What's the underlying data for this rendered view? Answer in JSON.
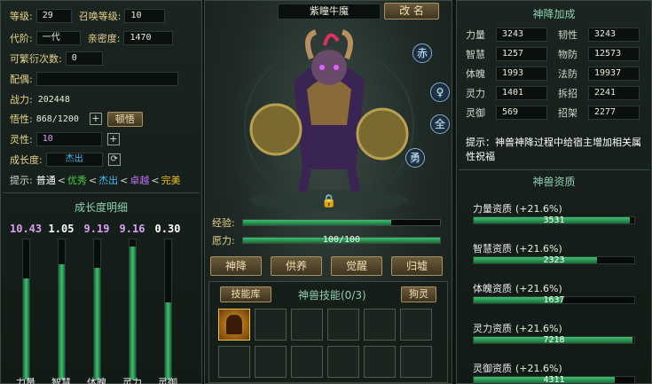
{
  "left": {
    "level_label": "等级:",
    "level": "29",
    "summon_level_label": "召唤等级:",
    "summon_level": "10",
    "generation_label": "代阶:",
    "generation": "一代",
    "intimacy_label": "亲密度:",
    "intimacy": "1470",
    "breed_label": "可繁衍次数:",
    "breed": "0",
    "mate_label": "配偶:",
    "mate": "",
    "power_label": "战力:",
    "power": "202448",
    "insight_label": "悟性:",
    "insight": "868/1200",
    "insight_button": "顿悟",
    "spirit_label": "灵性:",
    "spirit": "10",
    "growth_label": "成长度:",
    "growth": "杰出",
    "hint_label": "提示:",
    "hint_grades": [
      {
        "text": "普通",
        "color": "#ffffff"
      },
      {
        "text": "优秀",
        "color": "#4ad04a"
      },
      {
        "text": "杰出",
        "color": "#4ab8f0"
      },
      {
        "text": "卓越",
        "color": "#c070f0"
      },
      {
        "text": "完美",
        "color": "#f0c020"
      }
    ],
    "hint_separator": "<",
    "growth_title": "成长度明细",
    "growth_bars": [
      {
        "label": "力量",
        "value": "10.43",
        "color": "#d8a0f0",
        "fill": 0.72
      },
      {
        "label": "智慧",
        "value": "1.05",
        "color": "#ffffff",
        "fill": 0.82
      },
      {
        "label": "体魄",
        "value": "9.19",
        "color": "#d8a0f0",
        "fill": 0.8
      },
      {
        "label": "灵力",
        "value": "9.16",
        "color": "#d8a0f0",
        "fill": 0.95
      },
      {
        "label": "灵御",
        "value": "0.30",
        "color": "#ffffff",
        "fill": 0.55
      }
    ]
  },
  "center": {
    "pet_name": "紫瞳牛魔",
    "rename_button": "改 名",
    "side_icons": [
      "赤",
      "♀",
      "全",
      "勇"
    ],
    "exp_label": "经验:",
    "exp_value": "",
    "exp_fill": 0.75,
    "wish_label": "愿力:",
    "wish_value": "100/100",
    "wish_fill": 1.0,
    "actions": [
      "神降",
      "供养",
      "觉醒",
      "归墟"
    ],
    "skill_lib_button": "技能库",
    "skill_title": "神兽技能(0/3)",
    "capture_button": "狗灵"
  },
  "right": {
    "title": "神降加成",
    "stats": [
      {
        "label": "力量",
        "value": "3243"
      },
      {
        "label": "韧性",
        "value": "3243"
      },
      {
        "label": "智慧",
        "value": "1257"
      },
      {
        "label": "物防",
        "value": "12573"
      },
      {
        "label": "体魄",
        "value": "1993"
      },
      {
        "label": "法防",
        "value": "19937"
      },
      {
        "label": "灵力",
        "value": "1401"
      },
      {
        "label": "拆招",
        "value": "2241"
      },
      {
        "label": "灵御",
        "value": "569"
      },
      {
        "label": "招架",
        "value": "2277"
      }
    ],
    "tip": "提示：神兽神降过程中给宿主增加相关属性祝福",
    "aptitude_title": "神兽资质",
    "aptitudes": [
      {
        "label": "力量资质",
        "pct": "(+21.6%)",
        "value": "3531",
        "fill": 0.97
      },
      {
        "label": "智慧资质",
        "pct": "(+21.6%)",
        "value": "2323",
        "fill": 0.77
      },
      {
        "label": "体魄资质",
        "pct": "(+21.6%)",
        "value": "1637",
        "fill": 0.55
      },
      {
        "label": "灵力资质",
        "pct": "(+21.6%)",
        "value": "7218",
        "fill": 0.99
      },
      {
        "label": "灵御资质",
        "pct": "(+21.6%)",
        "value": "4311",
        "fill": 0.88
      }
    ]
  },
  "colors": {
    "accent_gold": "#e8d28a",
    "bar_green": "#3ac070",
    "title_teal": "#8fd0b0"
  }
}
